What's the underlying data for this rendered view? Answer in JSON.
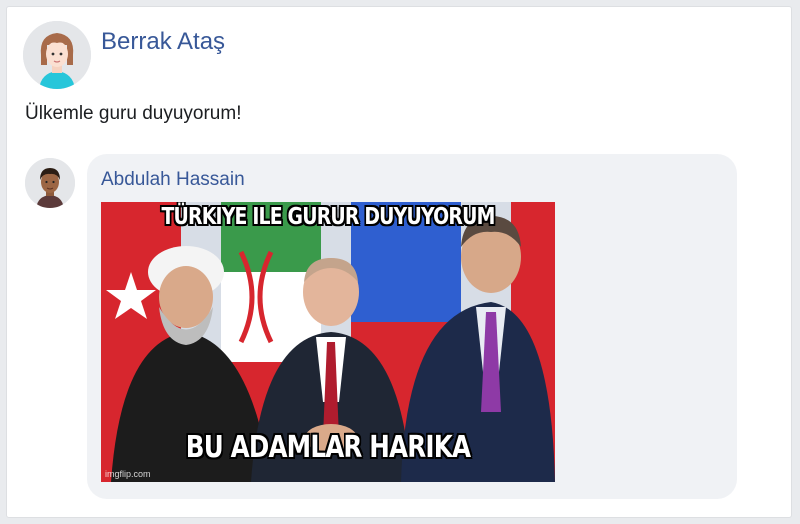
{
  "post": {
    "author_name": "Berrak Ataş",
    "text": "Ülkemle guru duyuyorum!"
  },
  "comment": {
    "author_name": "Abdulah Hassain",
    "meme": {
      "top_caption": "TÜRKIYE ILE GURUR DUYUYORUM",
      "bottom_caption": "BU ADAMLAR HARIKA",
      "watermark": "imgflip.com"
    }
  },
  "colors": {
    "link": "#385898",
    "bubble": "#f0f2f5",
    "text": "#1c1e21"
  }
}
